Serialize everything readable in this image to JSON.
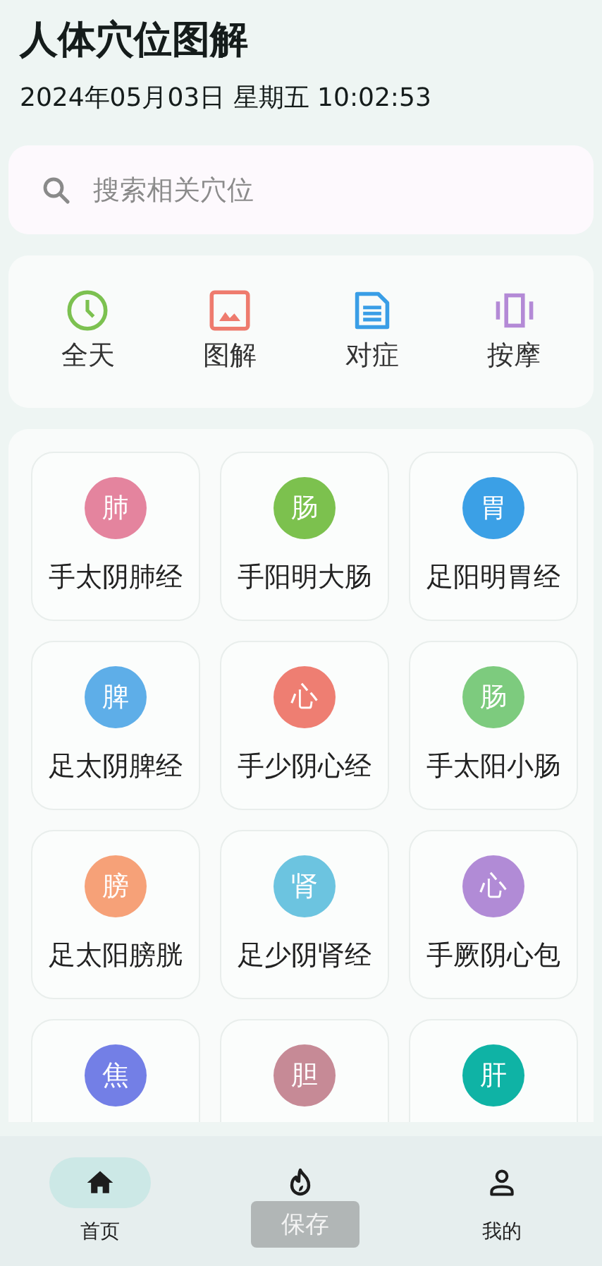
{
  "header": {
    "title": "人体穴位图解",
    "datetime": "2024年05月03日 星期五  10:02:53"
  },
  "search": {
    "placeholder": "搜索相关穴位"
  },
  "shortcuts": [
    {
      "kind": "clock",
      "label": "全天",
      "color": "#7cc150"
    },
    {
      "kind": "image",
      "label": "图解",
      "color": "#ee7b6e"
    },
    {
      "kind": "document",
      "label": "对症",
      "color": "#3a9ee6"
    },
    {
      "kind": "vibrate",
      "label": "按摩",
      "color": "#b48ad6"
    }
  ],
  "meridians": [
    {
      "badge": "肺",
      "name": "手太阴肺经",
      "color": "#e4849e"
    },
    {
      "badge": "肠",
      "name": "手阳明大肠",
      "color": "#7cc14e"
    },
    {
      "badge": "胃",
      "name": "足阳明胃经",
      "color": "#3ba0e6"
    },
    {
      "badge": "脾",
      "name": "足太阴脾经",
      "color": "#5eaee8"
    },
    {
      "badge": "心",
      "name": "手少阴心经",
      "color": "#ee7e72"
    },
    {
      "badge": "肠",
      "name": "手太阳小肠",
      "color": "#7dcb7e"
    },
    {
      "badge": "膀",
      "name": "足太阳膀胱",
      "color": "#f6a178"
    },
    {
      "badge": "肾",
      "name": "足少阴肾经",
      "color": "#6cc4e0"
    },
    {
      "badge": "心",
      "name": "手厥阴心包",
      "color": "#b18bd6"
    },
    {
      "badge": "焦",
      "color": "#737fe6"
    },
    {
      "badge": "胆",
      "color": "#c68a96"
    },
    {
      "badge": "肝",
      "color": "#0fb3a5"
    }
  ],
  "nav": [
    {
      "kind": "home",
      "label": "首页",
      "selected": true
    },
    {
      "kind": "flame",
      "selected": false
    },
    {
      "kind": "person",
      "label": "我的",
      "selected": false
    }
  ],
  "toast": {
    "text": "保存"
  }
}
